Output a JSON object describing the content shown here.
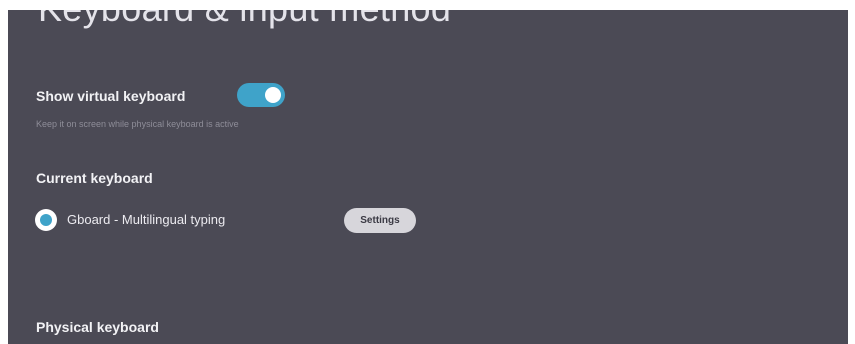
{
  "page": {
    "title": "Keyboard & input method"
  },
  "virtual_keyboard": {
    "label": "Show virtual keyboard",
    "description": "Keep it on screen while physical keyboard is active",
    "toggle_on": true
  },
  "current_keyboard": {
    "heading": "Current keyboard",
    "selected_name": "Gboard - Multilingual typing",
    "settings_label": "Settings"
  },
  "physical_keyboard": {
    "heading": "Physical keyboard"
  },
  "colors": {
    "background": "#4b4a55",
    "accent": "#3fa3c9",
    "button_bg": "#d7d6db"
  }
}
